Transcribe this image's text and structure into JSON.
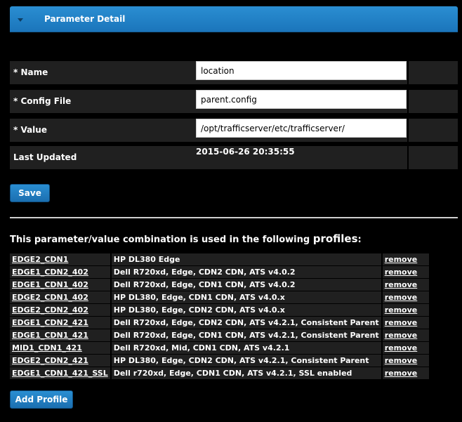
{
  "header": {
    "title": "Parameter Detail"
  },
  "form": {
    "name_label": "* Name",
    "name_value": "location",
    "config_label": "* Config File",
    "config_value": "parent.config",
    "value_label": "* Value",
    "value_value": "/opt/trafficserver/etc/trafficserver/",
    "updated_label": "Last Updated",
    "updated_value": "2015-06-26 20:35:55"
  },
  "buttons": {
    "save": "Save",
    "add_profile": "Add Profile"
  },
  "profiles_intro": {
    "prefix": "This parameter/value combination is used in the following ",
    "emphasis": "profiles",
    "suffix": ":"
  },
  "profiles": [
    {
      "name": "EDGE2_CDN1",
      "description": "HP DL380 Edge",
      "action": "remove"
    },
    {
      "name": "EDGE1_CDN2_402",
      "description": "Dell R720xd, Edge, CDN2 CDN, ATS v4.0.2",
      "action": "remove"
    },
    {
      "name": "EDGE1_CDN1_402",
      "description": "Dell R720xd, Edge, CDN1 CDN, ATS v4.0.2",
      "action": "remove"
    },
    {
      "name": "EDGE2_CDN1_402",
      "description": "HP DL380, Edge, CDN1 CDN, ATS v4.0.x",
      "action": "remove"
    },
    {
      "name": "EDGE2_CDN2_402",
      "description": "HP DL380, Edge, CDN2 CDN, ATS v4.0.x",
      "action": "remove"
    },
    {
      "name": "EDGE1_CDN2_421",
      "description": "Dell R720xd, Edge, CDN2 CDN, ATS v4.2.1, Consistent Parent",
      "action": "remove"
    },
    {
      "name": "EDGE1_CDN1_421",
      "description": "Dell R720xd, Edge, CDN1 CDN, ATS v4.2.1, Consistent Parent",
      "action": "remove"
    },
    {
      "name": "MID1_CDN1_421",
      "description": "Dell R720xd, Mid, CDN1 CDN, ATS v4.2.1",
      "action": "remove"
    },
    {
      "name": "EDGE2_CDN2_421",
      "description": "HP DL380, Edge, CDN2 CDN, ATS v4.2.1, Consistent Parent",
      "action": "remove"
    },
    {
      "name": "EDGE1_CDN1_421_SSL",
      "description": "Dell r720xd, Edge, CDN1 CDN, ATS v4.2.1, SSL enabled",
      "action": "remove"
    }
  ]
}
